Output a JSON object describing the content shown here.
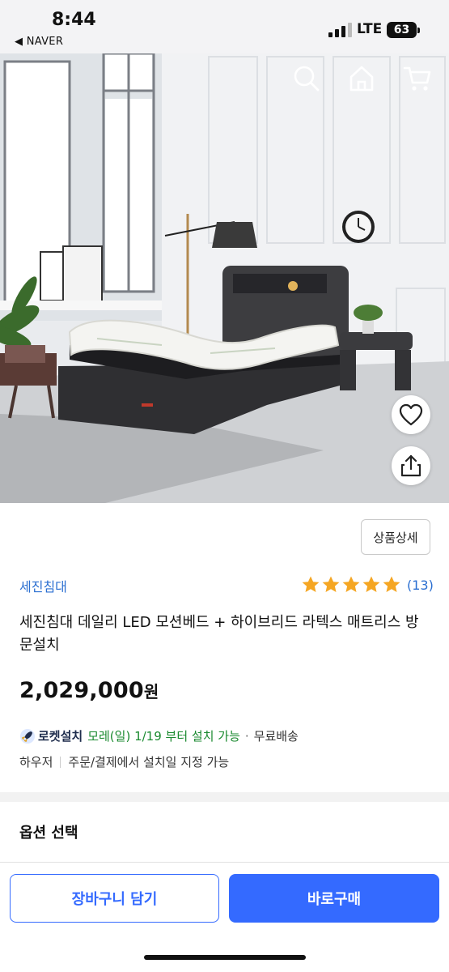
{
  "status_bar": {
    "time": "8:44",
    "back_app": "◀ NAVER",
    "network": "LTE",
    "battery": "63"
  },
  "hero": {
    "nav_icons": [
      "back-arrow-icon",
      "search-icon",
      "home-icon",
      "cart-icon"
    ],
    "actions": [
      "heart-icon",
      "share-icon"
    ]
  },
  "product": {
    "detail_button": "상품상세",
    "brand": "세진침대",
    "rating": {
      "stars": 5,
      "count": "(13)"
    },
    "title": "세진침대 데일리 LED 모션베드 + 하이브리드 라텍스 매트리스 방문설치",
    "price": "2,029,000",
    "price_unit": "원"
  },
  "delivery": {
    "rocket_label": "로켓설치",
    "date_text": "모레(일) 1/19 부터 설치 가능",
    "separator": "·",
    "shipping": "무료배송"
  },
  "install": {
    "brand": "하우저",
    "note": "주문/결제에서 설치일 지정 가능"
  },
  "options": {
    "title": "옵션 선택"
  },
  "buttons": {
    "cart": "장바구니 담기",
    "buy": "바로구매"
  },
  "colors": {
    "accent": "#346aff",
    "brand_link": "#2b6fd1",
    "star": "#f5a623",
    "rocket_date": "#1a8a2f"
  }
}
